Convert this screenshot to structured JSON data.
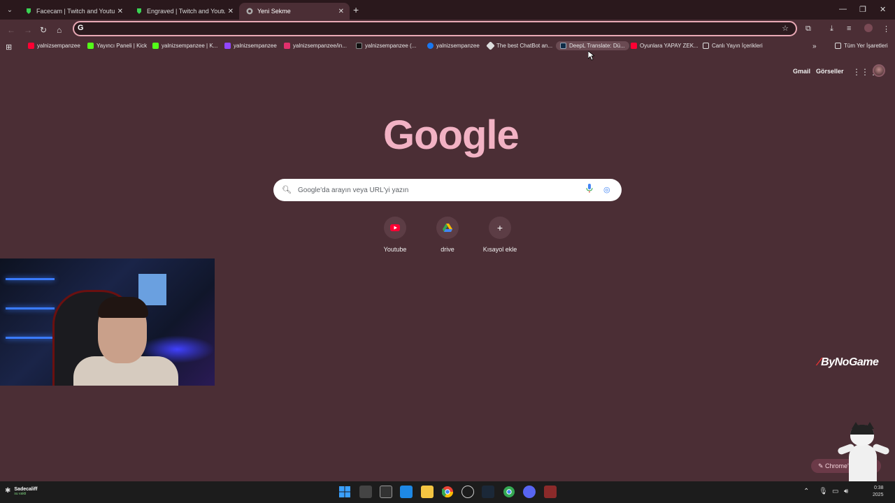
{
  "tabs": [
    {
      "title": "Facecam | Twitch and Youtube",
      "favicon_color": "#39d353"
    },
    {
      "title": "Engraved | Twitch and Youtube",
      "favicon_color": "#39d353"
    },
    {
      "title": "Yeni Sekme",
      "favicon_color": "#bbbbbb",
      "active": true
    }
  ],
  "omnibox": {
    "value": "",
    "placeholder": ""
  },
  "bookmarks": [
    {
      "label": "yalnizsempanzee",
      "color": "#ff0033"
    },
    {
      "label": "Yayıncı Paneli | Kick",
      "color": "#53fc18"
    },
    {
      "label": "yalnizsempanzee | K...",
      "color": "#53fc18"
    },
    {
      "label": "yalnizsempanzee",
      "color": "#9146ff"
    },
    {
      "label": "yalnizsempanzee/in...",
      "color": "#e1306c"
    },
    {
      "label": "yalnizsempanzee (...",
      "color": "#111111"
    },
    {
      "label": "yalnizsempanzee",
      "color": "#1877f2"
    },
    {
      "label": "The best ChatBot an...",
      "color": "#dddddd"
    },
    {
      "label": "DeepL Translate: Dü...",
      "color": "#0f2b46"
    },
    {
      "label": "Oyunlara YAPAY ZEK...",
      "color": "#ff0033"
    },
    {
      "label": "Canlı Yayın İçerikleri",
      "color": "#dddddd"
    }
  ],
  "bookmarks_all": "Tüm Yer İşaretleri",
  "top_links": {
    "gmail": "Gmail",
    "images": "Görseller"
  },
  "logo": "Google",
  "search": {
    "placeholder": "Google'da arayın veya URL'yi yazın"
  },
  "shortcuts": [
    {
      "label": "Youtube"
    },
    {
      "label": "drive"
    },
    {
      "label": "Kısayol ekle"
    }
  ],
  "brand": "ByNoGame",
  "customize": "Chrome'",
  "taskbar": {
    "user_name": "Sadecaliff",
    "user_status": "su vakti",
    "time": "0:38",
    "year": "2025",
    "apps": [
      "windows-start",
      "task-view",
      "file-manager",
      "photos",
      "explorer",
      "chrome",
      "obs",
      "steam",
      "chrome-2",
      "discord",
      "winrar"
    ]
  }
}
